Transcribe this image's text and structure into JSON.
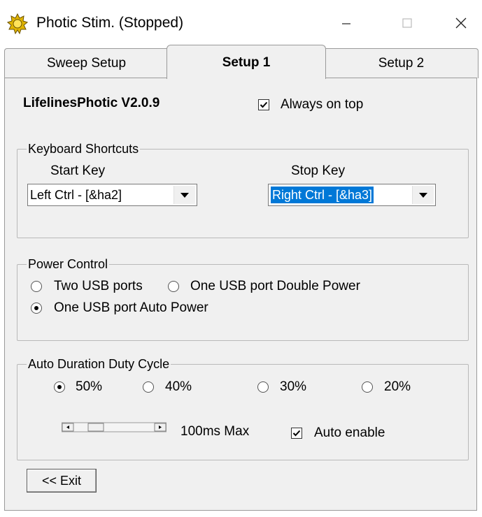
{
  "window": {
    "title": "Photic Stim. (Stopped)",
    "minimize_icon": "minimize-icon",
    "maximize_icon": "maximize-icon",
    "close_icon": "close-icon"
  },
  "tabs": [
    {
      "label": "Sweep Setup",
      "selected": false
    },
    {
      "label": "Setup 1",
      "selected": true
    },
    {
      "label": "Setup 2",
      "selected": false
    }
  ],
  "setup1": {
    "app_name": "LifelinesPhotic V2.0.9",
    "always_on_top": {
      "label": "Always on top",
      "checked": true
    },
    "keyboard_shortcuts": {
      "title": "Keyboard Shortcuts",
      "start_key": {
        "label": "Start Key",
        "value": "Left Ctrl - [&ha2]"
      },
      "stop_key": {
        "label": "Stop Key",
        "value": "Right Ctrl - [&ha3]"
      }
    },
    "power_control": {
      "title": "Power Control",
      "options": [
        {
          "label": "Two USB ports",
          "selected": false
        },
        {
          "label": "One USB port Double Power",
          "selected": false
        },
        {
          "label": "One USB port Auto Power",
          "selected": true
        }
      ]
    },
    "auto_duration": {
      "title": "Auto Duration Duty Cycle",
      "options": [
        {
          "label": "50%",
          "selected": true
        },
        {
          "label": "40%",
          "selected": false
        },
        {
          "label": "30%",
          "selected": false
        },
        {
          "label": "20%",
          "selected": false
        }
      ],
      "max_label": "100ms Max",
      "auto_enable": {
        "label": "Auto enable",
        "checked": true
      }
    },
    "exit_button": "<< Exit"
  },
  "colors": {
    "accent": "#0078d7",
    "panel": "#f0f0f0"
  }
}
